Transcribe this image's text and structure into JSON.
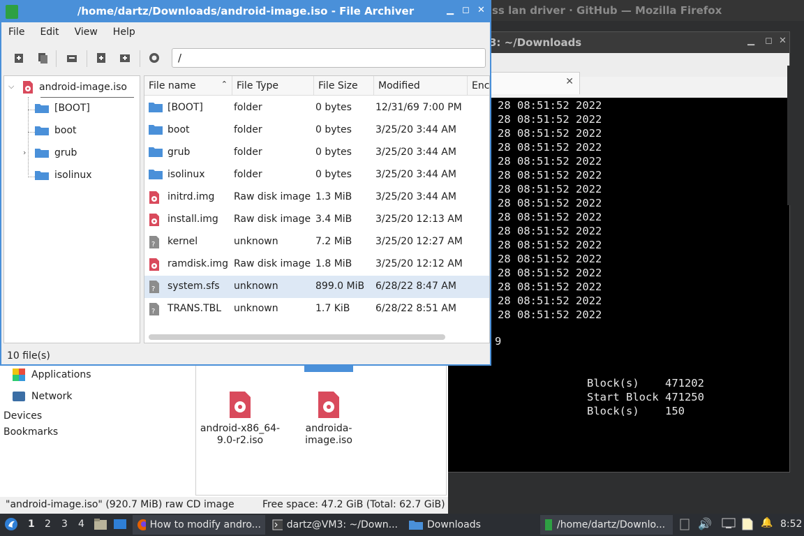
{
  "firefox": {
    "title": "ss lan driver · GitHub — Mozilla Firefox"
  },
  "terminal": {
    "title": "3: ~/Downloads",
    "lines": [
      "28 08:51:52 2022",
      "28 08:51:52 2022",
      "28 08:51:52 2022",
      "28 08:51:52 2022",
      "28 08:51:52 2022",
      "28 08:51:52 2022",
      "28 08:51:52 2022",
      "28 08:51:52 2022",
      "28 08:51:52 2022",
      "28 08:51:52 2022",
      "28 08:51:52 2022",
      "28 08:51:52 2022",
      "28 08:51:52 2022",
      "28 08:51:52 2022",
      "28 08:51:52 2022",
      "28 08:51:52 2022"
    ],
    "nine": "9",
    "block1": "Block(s)    471202",
    "block2": "Start Block 471250",
    "block3": "Block(s)    150"
  },
  "archiver": {
    "title": "/home/dartz/Downloads/android-image.iso - File Archiver",
    "menu": [
      "File",
      "Edit",
      "View",
      "Help"
    ],
    "path": "/",
    "tree": {
      "root": "android-image.iso",
      "children": [
        "[BOOT]",
        "boot",
        "grub",
        "isolinux"
      ]
    },
    "columns": [
      "File name",
      "File Type",
      "File Size",
      "Modified",
      "Encr"
    ],
    "rows": [
      {
        "name": "[BOOT]",
        "type": "folder",
        "size": "0 bytes",
        "modified": "12/31/69 7:00 PM",
        "icon": "folder"
      },
      {
        "name": "boot",
        "type": "folder",
        "size": "0 bytes",
        "modified": "3/25/20 3:44 AM",
        "icon": "folder"
      },
      {
        "name": "grub",
        "type": "folder",
        "size": "0 bytes",
        "modified": "3/25/20 3:44 AM",
        "icon": "folder"
      },
      {
        "name": "isolinux",
        "type": "folder",
        "size": "0 bytes",
        "modified": "3/25/20 3:44 AM",
        "icon": "folder"
      },
      {
        "name": "initrd.img",
        "type": "Raw disk image",
        "size": "1.3 MiB",
        "modified": "3/25/20 3:44 AM",
        "icon": "disk"
      },
      {
        "name": "install.img",
        "type": "Raw disk image",
        "size": "3.4 MiB",
        "modified": "3/25/20 12:13 AM",
        "icon": "disk"
      },
      {
        "name": "kernel",
        "type": "unknown",
        "size": "7.2 MiB",
        "modified": "3/25/20 12:27 AM",
        "icon": "unknown"
      },
      {
        "name": "ramdisk.img",
        "type": "Raw disk image",
        "size": "1.8 MiB",
        "modified": "3/25/20 12:12 AM",
        "icon": "disk"
      },
      {
        "name": "system.sfs",
        "type": "unknown",
        "size": "899.0 MiB",
        "modified": "6/28/22 8:47 AM",
        "icon": "unknown"
      },
      {
        "name": "TRANS.TBL",
        "type": "unknown",
        "size": "1.7 KiB",
        "modified": "6/28/22 8:51 AM",
        "icon": "unknown"
      }
    ],
    "status": "10 file(s)"
  },
  "files": {
    "sidebar": {
      "applications": "Applications",
      "network": "Network",
      "devices": "Devices",
      "bookmarks": "Bookmarks"
    },
    "tiles": [
      "android-x86_64-9.0-r2.iso",
      "androida-image.iso"
    ],
    "selected_tag": "image.iso",
    "status_left": "\"android-image.iso\" (920.7 MiB) raw CD image",
    "status_right": "Free space: 47.2 GiB (Total: 62.7 GiB)"
  },
  "taskbar": {
    "workspaces": [
      "1",
      "2",
      "3",
      "4"
    ],
    "tasks": [
      "How to modify andro...",
      "dartz@VM3: ~/Down...",
      "Downloads",
      "/home/dartz/Downlo..."
    ],
    "clock": "8:52"
  },
  "colors": {
    "accent": "#4a90d9",
    "folder": "#4a90d9",
    "disk": "#d9534f"
  }
}
